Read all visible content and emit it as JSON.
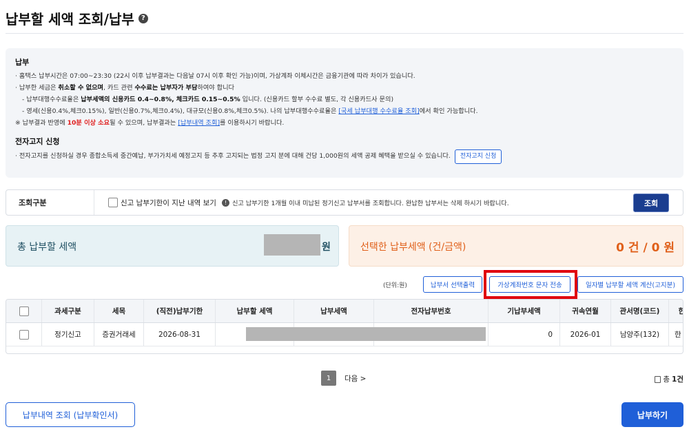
{
  "page": {
    "title": "납부할 세액 조회/납부",
    "help_glyph": "?"
  },
  "info": {
    "payment_heading": "납부",
    "line1": "· 홈택스 납부시간은 07:00~23:30 (22시 이후 납부결과는 다음날 07시 이후 확인 가능)이며, 가상계좌 이체시간은 금융기관에 따라 차이가 있습니다.",
    "line2_a": "· 납부한 세금은 ",
    "line2_b": "취소할 수 없으며",
    "line2_c": ", 카드 관련 ",
    "line2_d": "수수료는 납부자가 부담",
    "line2_e": "하여야 합니다",
    "line3_a": "- 납부대행수수료율은 ",
    "line3_b": "납부세액의 신용카드 0.4~0.8%, 체크카드 0.15~0.5%",
    "line3_c": " 입니다. (신용카드 할부 수수료 별도, 각 신용카드사 문의)",
    "line4_a": "- 영세(신용0.4%,체크0.15%), 일반(신용0.7%,체크0.4%), 대규모(신용0.8%,체크0.5%). 나의 납부대행수수료율은 ",
    "line4_link": "[국세 납부대행 수수료율 조회]",
    "line4_b": "에서 확인 가능합니다.",
    "line5_a": "※ 납부결과 반영에 ",
    "line5_red": "10분 이상 소요",
    "line5_b": "될 수 있으며, 납부결과는 ",
    "line5_link": "[납부내역 조회]",
    "line5_c": "를 이용하시기 바랍니다.",
    "e_notice_heading": "전자고지 신청",
    "e_notice_line": "· 전자고지를 신청하실 경우 종합소득세 중간예납, 부가가치세 예정고지 등 추후 고지되는 법정 고지 분에 대해 건당 1,000원의 세액 공제 혜택을 받으실 수 있습니다.",
    "e_notice_button": "전자고지 신청"
  },
  "search": {
    "label": "조회구분",
    "checkbox_label": "신고 납부기한이 지난 내역 보기",
    "notice_glyph": "!",
    "notice": "신고 납부기한 1개월 이내 미납된 정기신고 납부서를 조회합니다. 완납한 납부서는 삭제 하시기 바랍니다.",
    "button": "조회"
  },
  "summary": {
    "total_label": "총 납부할 세액",
    "total_unit": "원",
    "selected_label": "선택한 납부세액 (건/금액)",
    "selected_value": "0 건 / 0 원"
  },
  "toolbar": {
    "unit_note": "(단위:원)",
    "print_button": "납부서 선택출력",
    "sms_button": "가상계좌번호 문자 전송",
    "daily_button": "일자별 납부할 세액 계산(고지분)"
  },
  "table": {
    "headers": [
      "과세구분",
      "세목",
      "(직전)납부기한",
      "납부할 세액",
      "납부세액",
      "전자납부번호",
      "기납부세액",
      "귀속연월",
      "관서명(코드)",
      "한"
    ],
    "rows": [
      [
        "정기신고",
        "증권거래세",
        "2026-08-31",
        "",
        "",
        "",
        "0",
        "2026-01",
        "남양주(132)",
        "한"
      ]
    ]
  },
  "pagination": {
    "current": "1",
    "next": "다음 >",
    "count_prefix": "총",
    "count_value": "1건"
  },
  "footer": {
    "history_button": "납부내역 조회 (납부확인서)",
    "pay_button": "납부하기"
  }
}
